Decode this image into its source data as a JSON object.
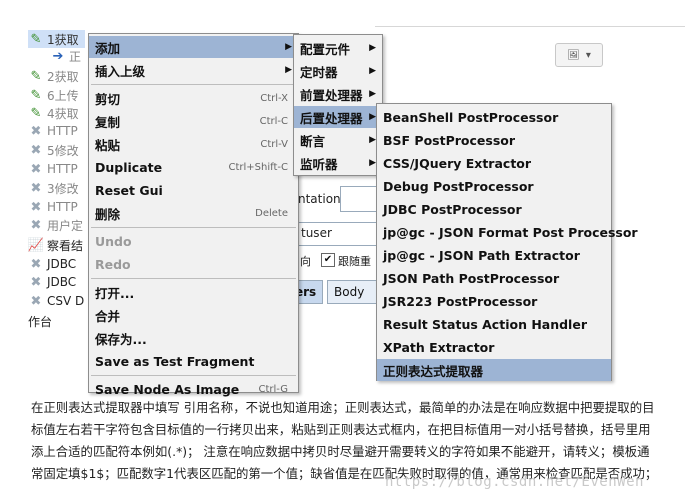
{
  "tree": {
    "rows": [
      {
        "icon": "pencil-icon",
        "text": "1获取",
        "selected": true
      },
      {
        "icon": "arrow-icon",
        "text": "正",
        "selected": false
      },
      {
        "icon": "pencil-icon",
        "text": "2获取",
        "selected": false
      },
      {
        "icon": "pencil-icon",
        "text": "6上传",
        "selected": false
      },
      {
        "icon": "pencil-icon",
        "text": "4获取",
        "selected": false
      },
      {
        "icon": "cross-icon",
        "text": "HTTP",
        "selected": false
      },
      {
        "icon": "cross-icon",
        "text": "5修改",
        "selected": false
      },
      {
        "icon": "cross-icon",
        "text": "HTTP",
        "selected": false
      },
      {
        "icon": "cross-icon",
        "text": "3修改",
        "selected": false
      },
      {
        "icon": "cross-icon",
        "text": "HTTP",
        "selected": false
      },
      {
        "icon": "cross-icon",
        "text": "用户定",
        "selected": false
      },
      {
        "icon": "graph-icon",
        "text": "察看结",
        "selected": false
      },
      {
        "icon": "cross-icon",
        "text": "JDBC",
        "selected": false
      },
      {
        "icon": "cross-icon",
        "text": "JDBC",
        "selected": false
      },
      {
        "icon": "cross-icon",
        "text": "CSV D",
        "selected": false
      }
    ],
    "bottom_label": "作台"
  },
  "background": {
    "label_implementation": "ntation:",
    "label_user": "tuser",
    "label_dir": "向",
    "checkbox_label": "跟随重",
    "tab_1": "ers",
    "tab_2": "Body D"
  },
  "context_menu": {
    "items": [
      {
        "label": "添加",
        "shortcut": "",
        "submenu": true,
        "disabled": false,
        "highlight": true
      },
      {
        "label": "插入上级",
        "shortcut": "",
        "submenu": true,
        "disabled": false,
        "highlight": false
      },
      {
        "sep": true
      },
      {
        "label": "剪切",
        "shortcut": "Ctrl-X",
        "submenu": false,
        "disabled": false
      },
      {
        "label": "复制",
        "shortcut": "Ctrl-C",
        "submenu": false,
        "disabled": false
      },
      {
        "label": "粘贴",
        "shortcut": "Ctrl-V",
        "submenu": false,
        "disabled": false
      },
      {
        "label": "Duplicate",
        "shortcut": "Ctrl+Shift-C",
        "submenu": false,
        "disabled": false
      },
      {
        "label": "Reset Gui",
        "shortcut": "",
        "submenu": false,
        "disabled": false
      },
      {
        "label": "删除",
        "shortcut": "Delete",
        "submenu": false,
        "disabled": false
      },
      {
        "sep": true
      },
      {
        "label": "Undo",
        "shortcut": "",
        "submenu": false,
        "disabled": true
      },
      {
        "label": "Redo",
        "shortcut": "",
        "submenu": false,
        "disabled": true
      },
      {
        "sep": true
      },
      {
        "label": "打开...",
        "shortcut": "",
        "submenu": false,
        "disabled": false
      },
      {
        "label": "合并",
        "shortcut": "",
        "submenu": false,
        "disabled": false
      },
      {
        "label": "保存为...",
        "shortcut": "",
        "submenu": false,
        "disabled": false
      },
      {
        "label": "Save as Test Fragment",
        "shortcut": "",
        "submenu": false,
        "disabled": false
      },
      {
        "sep": true
      },
      {
        "label": "Save Node As Image",
        "shortcut": "Ctrl-G",
        "submenu": false,
        "disabled": false
      }
    ]
  },
  "add_submenu": {
    "items": [
      {
        "label": "配置元件",
        "highlight": false
      },
      {
        "label": "定时器",
        "highlight": false
      },
      {
        "label": "前置处理器",
        "highlight": false
      },
      {
        "label": "后置处理器",
        "highlight": true
      },
      {
        "label": "断言",
        "highlight": false
      },
      {
        "label": "监听器",
        "highlight": false
      }
    ]
  },
  "postprocessor_submenu": {
    "items": [
      {
        "label": "BeanShell PostProcessor",
        "highlight": false
      },
      {
        "label": "BSF PostProcessor",
        "highlight": false
      },
      {
        "label": "CSS/JQuery Extractor",
        "highlight": false
      },
      {
        "label": "Debug PostProcessor",
        "highlight": false
      },
      {
        "label": "JDBC PostProcessor",
        "highlight": false
      },
      {
        "label": "jp@gc - JSON Format Post Processor",
        "highlight": false
      },
      {
        "label": "jp@gc - JSON Path Extractor",
        "highlight": false
      },
      {
        "label": "JSON Path PostProcessor",
        "highlight": false
      },
      {
        "label": "JSR223 PostProcessor",
        "highlight": false
      },
      {
        "label": "Result Status Action Handler",
        "highlight": false
      },
      {
        "label": "XPath Extractor",
        "highlight": false
      },
      {
        "label": "正则表达式提取器",
        "highlight": true
      }
    ]
  },
  "caption": {
    "text": "在正则表达式提取器中填写 引用名称，不说也知道用途；正则表达式，最简单的办法是在响应数据中把要提取的目标值左右若干字符包含目标值的一行拷贝出来，粘贴到正则表达式框内，在把目标值用一对小括号替换，括号里用添上合适的匹配符本例如(.*)； 注意在响应数据中拷贝时尽量避开需要转义的字符如果不能避开，请转义；模板通常固定填$1$；匹配数字1代表区匹配的第一个值；缺省值是在匹配失败时取得的值，通常用来检查匹配是否成功；"
  },
  "watermark": "https://blog.csdn.net/EvenWen"
}
